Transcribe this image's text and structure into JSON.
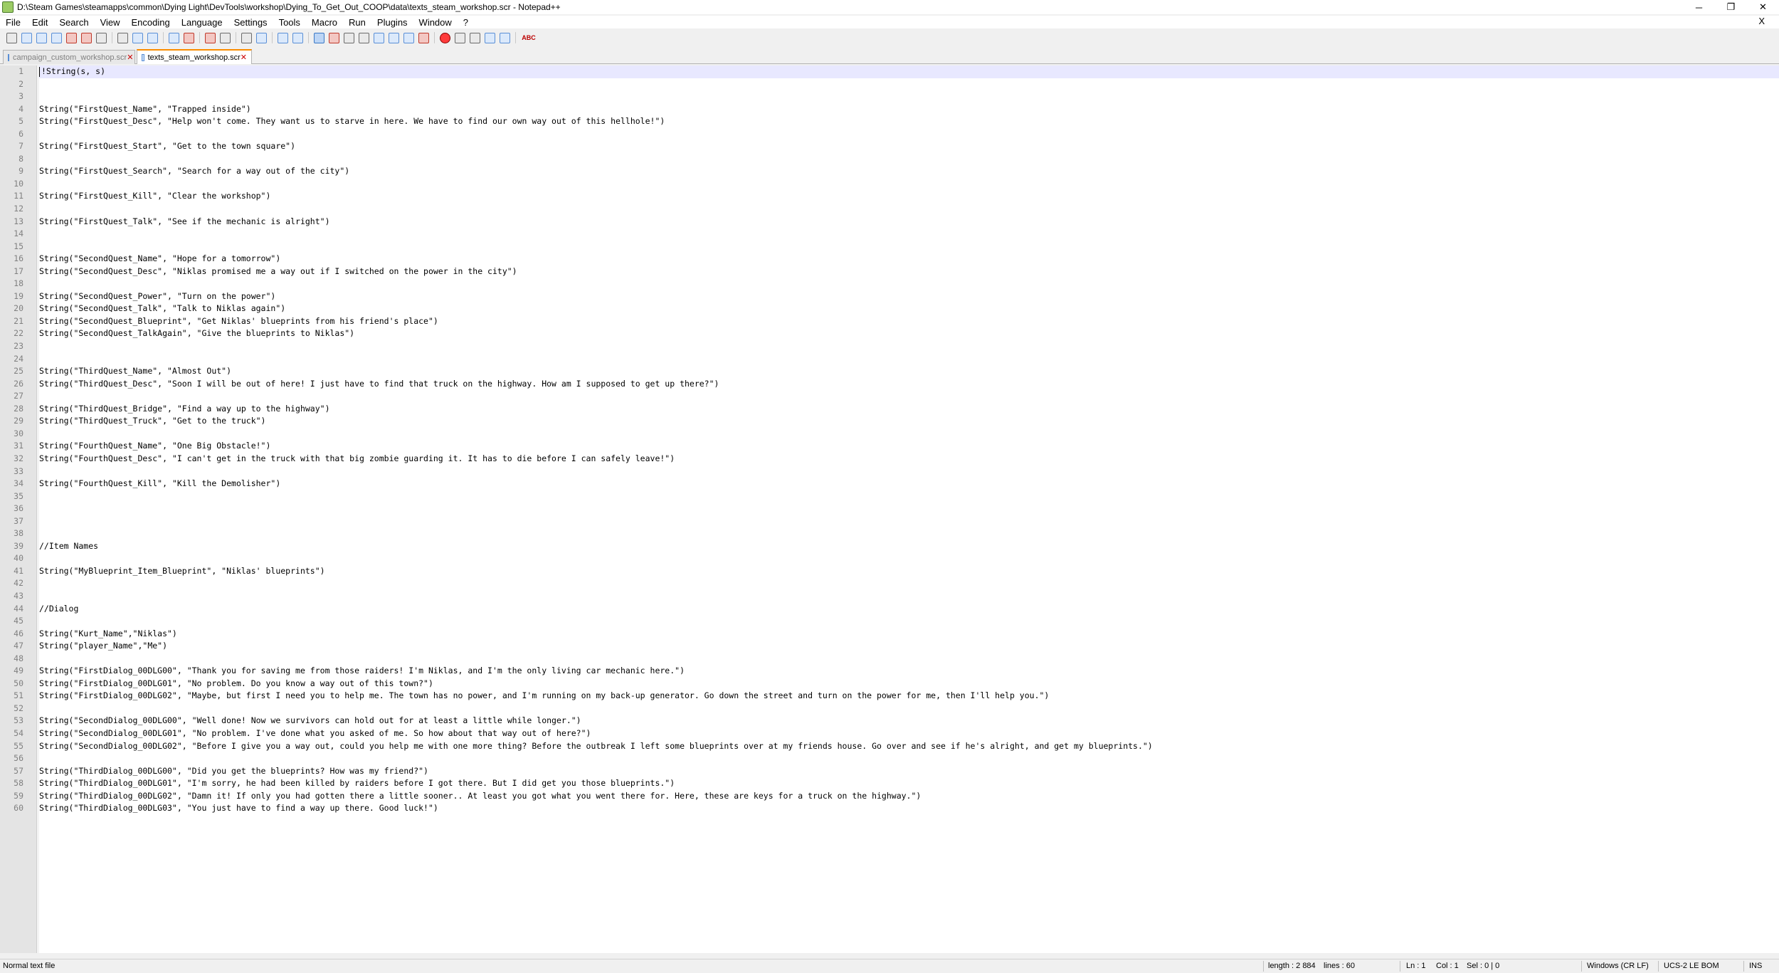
{
  "window": {
    "title": "D:\\Steam Games\\steamapps\\common\\Dying Light\\DevTools\\workshop\\Dying_To_Get_Out_COOP\\data\\texts_steam_workshop.scr - Notepad++",
    "minimize": "─",
    "restore": "❐",
    "close": "✕"
  },
  "menu": {
    "items": [
      "File",
      "Edit",
      "Search",
      "View",
      "Encoding",
      "Language",
      "Settings",
      "Tools",
      "Macro",
      "Run",
      "Plugins",
      "Window",
      "?"
    ],
    "close_doc": "X"
  },
  "toolbar": {
    "icons": [
      "new-file-icon",
      "open-file-icon",
      "save-icon",
      "save-all-icon",
      "close-icon",
      "close-all-icon",
      "print-icon",
      "sep",
      "cut-icon",
      "copy-icon",
      "paste-icon",
      "sep",
      "undo-icon",
      "redo-icon",
      "sep",
      "find-icon",
      "replace-icon",
      "sep",
      "zoom-in-icon",
      "zoom-out-icon",
      "sep",
      "sync-vertical-icon",
      "sync-horizontal-icon",
      "sep",
      "word-wrap-icon",
      "show-all-chars-icon",
      "indent-guide-icon",
      "udl-icon",
      "document-map-icon",
      "function-list-icon",
      "folder-workspace-icon",
      "monitoring-icon",
      "sep",
      "record-macro-icon",
      "stop-record-icon",
      "play-macro-icon",
      "play-multiple-icon",
      "save-macro-icon",
      "sep",
      "spellcheck-icon"
    ],
    "spellcheck_label": "ABC"
  },
  "tabs": [
    {
      "label": "campaign_custom_workshop.scr",
      "close": "✕",
      "active": false
    },
    {
      "label": "texts_steam_workshop.scr",
      "close": "✕",
      "active": true
    }
  ],
  "editor": {
    "current_line": 1,
    "lines": [
      "!String(s, s)",
      "",
      "",
      "String(\"FirstQuest_Name\", \"Trapped inside\")",
      "String(\"FirstQuest_Desc\", \"Help won't come. They want us to starve in here. We have to find our own way out of this hellhole!\")",
      "",
      "String(\"FirstQuest_Start\", \"Get to the town square\")",
      "",
      "String(\"FirstQuest_Search\", \"Search for a way out of the city\")",
      "",
      "String(\"FirstQuest_Kill\", \"Clear the workshop\")",
      "",
      "String(\"FirstQuest_Talk\", \"See if the mechanic is alright\")",
      "",
      "",
      "String(\"SecondQuest_Name\", \"Hope for a tomorrow\")",
      "String(\"SecondQuest_Desc\", \"Niklas promised me a way out if I switched on the power in the city\")",
      "",
      "String(\"SecondQuest_Power\", \"Turn on the power\")",
      "String(\"SecondQuest_Talk\", \"Talk to Niklas again\")",
      "String(\"SecondQuest_Blueprint\", \"Get Niklas' blueprints from his friend's place\")",
      "String(\"SecondQuest_TalkAgain\", \"Give the blueprints to Niklas\")",
      "",
      "",
      "String(\"ThirdQuest_Name\", \"Almost Out\")",
      "String(\"ThirdQuest_Desc\", \"Soon I will be out of here! I just have to find that truck on the highway. How am I supposed to get up there?\")",
      "",
      "String(\"ThirdQuest_Bridge\", \"Find a way up to the highway\")",
      "String(\"ThirdQuest_Truck\", \"Get to the truck\")",
      "",
      "String(\"FourthQuest_Name\", \"One Big Obstacle!\")",
      "String(\"FourthQuest_Desc\", \"I can't get in the truck with that big zombie guarding it. It has to die before I can safely leave!\")",
      "",
      "String(\"FourthQuest_Kill\", \"Kill the Demolisher\")",
      "",
      "",
      "",
      "",
      "//Item Names",
      "",
      "String(\"MyBlueprint_Item_Blueprint\", \"Niklas' blueprints\")",
      "",
      "",
      "//Dialog",
      "",
      "String(\"Kurt_Name\",\"Niklas\")",
      "String(\"player_Name\",\"Me\")",
      "",
      "String(\"FirstDialog_00DLG00\", \"Thank you for saving me from those raiders! I'm Niklas, and I'm the only living car mechanic here.\")",
      "String(\"FirstDialog_00DLG01\", \"No problem. Do you know a way out of this town?\")",
      "String(\"FirstDialog_00DLG02\", \"Maybe, but first I need you to help me. The town has no power, and I'm running on my back-up generator. Go down the street and turn on the power for me, then I'll help you.\")",
      "",
      "String(\"SecondDialog_00DLG00\", \"Well done! Now we survivors can hold out for at least a little while longer.\")",
      "String(\"SecondDialog_00DLG01\", \"No problem. I've done what you asked of me. So how about that way out of here?\")",
      "String(\"SecondDialog_00DLG02\", \"Before I give you a way out, could you help me with one more thing? Before the outbreak I left some blueprints over at my friends house. Go over and see if he's alright, and get my blueprints.\")",
      "",
      "String(\"ThirdDialog_00DLG00\", \"Did you get the blueprints? How was my friend?\")",
      "String(\"ThirdDialog_00DLG01\", \"I'm sorry, he had been killed by raiders before I got there. But I did get you those blueprints.\")",
      "String(\"ThirdDialog_00DLG02\", \"Damn it! If only you had gotten there a little sooner.. At least you got what you went there for. Here, these are keys for a truck on the highway.\")",
      "String(\"ThirdDialog_00DLG03\", \"You just have to find a way up there. Good luck!\")"
    ]
  },
  "status": {
    "file_type": "Normal text file",
    "length": "length : 2 884",
    "lines": "lines : 60",
    "ln": "Ln : 1",
    "col": "Col : 1",
    "sel": "Sel : 0 | 0",
    "eol": "Windows (CR LF)",
    "encoding": "UCS-2 LE BOM",
    "mode": "INS"
  }
}
